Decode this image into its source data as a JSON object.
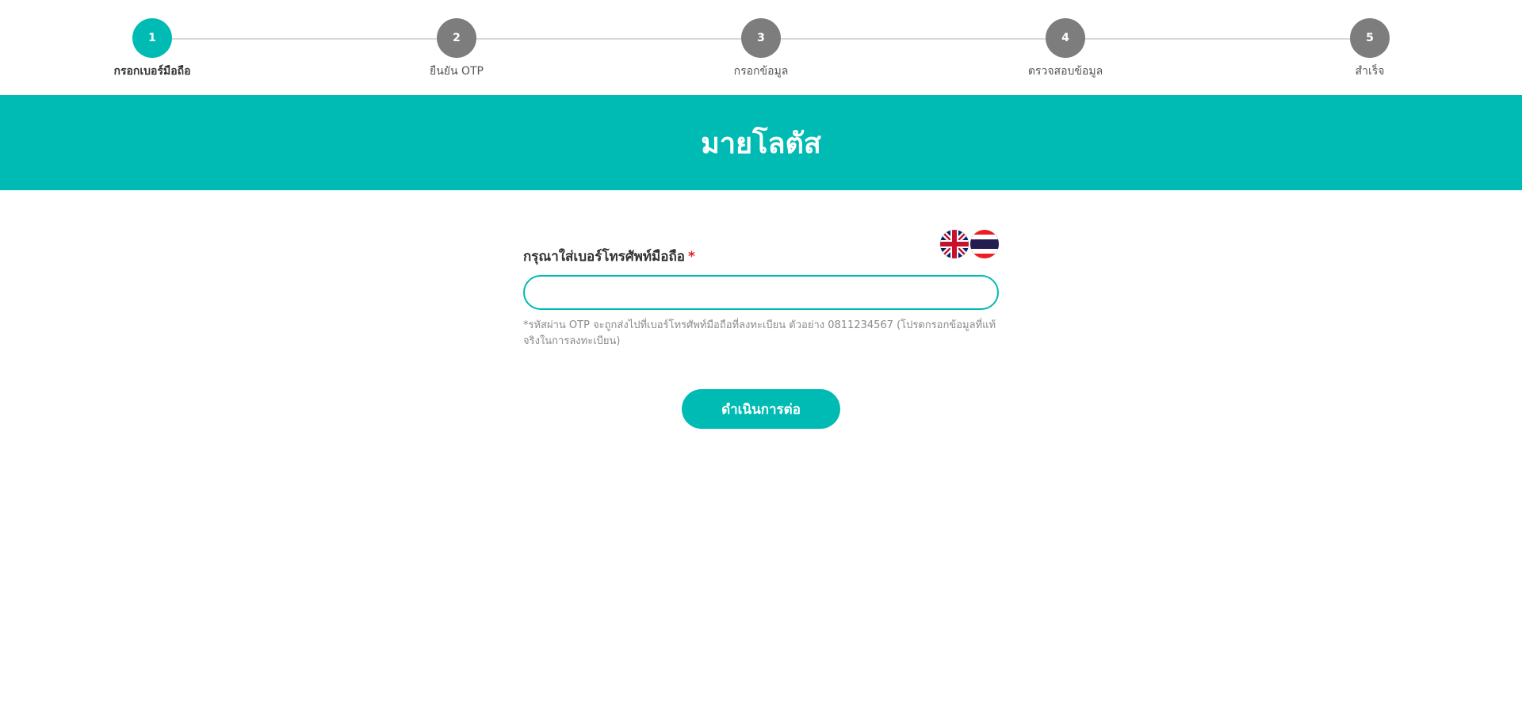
{
  "stepper": {
    "steps": [
      {
        "number": "1",
        "label": "กรอกเบอร์มือถือ"
      },
      {
        "number": "2",
        "label": "ยืนยัน OTP"
      },
      {
        "number": "3",
        "label": "กรอกข้อมูล"
      },
      {
        "number": "4",
        "label": "ตรวจสอบข้อมูล"
      },
      {
        "number": "5",
        "label": "สำเร็จ"
      }
    ],
    "active_step": 1,
    "active_color": "#00bbb4",
    "inactive_color": "#7d7d7d"
  },
  "banner": {
    "title": "มายโลตัส",
    "color": "#00bbb4"
  },
  "language": {
    "options": [
      {
        "name": "english-flag-icon"
      },
      {
        "name": "thai-flag-icon"
      }
    ]
  },
  "form": {
    "phone_label": "กรุณาใส่เบอร์โทรศัพท์มือถือ",
    "required_mark": "*",
    "phone_value": "",
    "phone_placeholder": "",
    "hint": "*รหัสผ่าน OTP จะถูกส่งไปที่เบอร์โทรศัพท์มือถือที่ลงทะเบียน ตัวอย่าง 0811234567 (โปรดกรอกข้อมูลที่แท้จริงในการลงทะเบียน)",
    "submit_label": "ดำเนินการต่อ"
  }
}
